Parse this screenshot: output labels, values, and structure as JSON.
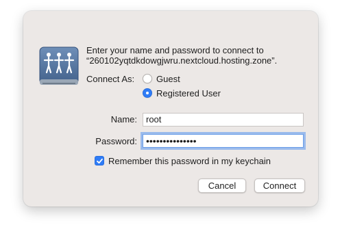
{
  "prompt": {
    "line1": "Enter your name and password to connect to",
    "line2": "“260102yqtdkdowgjwru.nextcloud.hosting.zone”."
  },
  "connect_as": {
    "label": "Connect As:",
    "options": [
      {
        "label": "Guest",
        "selected": false
      },
      {
        "label": "Registered User",
        "selected": true
      }
    ]
  },
  "name": {
    "label": "Name:",
    "value": "root"
  },
  "password": {
    "label": "Password:",
    "masked_value": "•••••••••••••••"
  },
  "remember": {
    "label": "Remember this password in my keychain",
    "checked": true
  },
  "buttons": {
    "cancel": "Cancel",
    "connect": "Connect"
  },
  "icons": {
    "server": "shared-server-drive-icon",
    "checkmark": "checkmark-icon"
  },
  "colors": {
    "accent": "#2f7cf6",
    "dialog_bg": "#ece8e6",
    "drive_blue": "#4d6f9a"
  }
}
